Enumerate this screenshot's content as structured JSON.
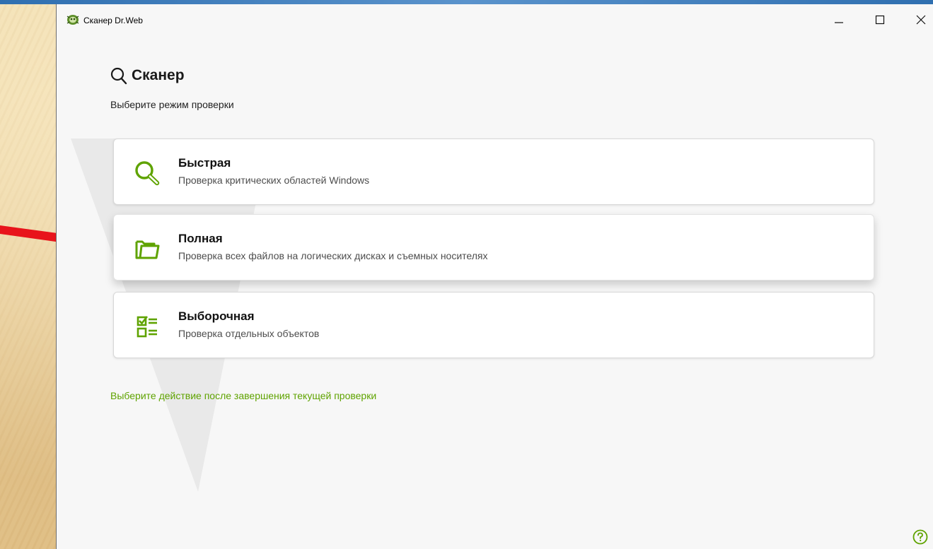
{
  "window": {
    "title": "Сканер Dr.Web"
  },
  "header": {
    "title": "Сканер",
    "subtitle": "Выберите режим проверки"
  },
  "scan_modes": [
    {
      "title": "Быстрая",
      "description": "Проверка критических областей Windows",
      "icon": "magnifier-icon"
    },
    {
      "title": "Полная",
      "description": "Проверка всех файлов на логических дисках и съемных носителях",
      "icon": "folder-icon"
    },
    {
      "title": "Выборочная",
      "description": "Проверка отдельных объектов",
      "icon": "checklist-icon"
    }
  ],
  "after_scan_link": "Выберите действие после завершения текущей проверки",
  "colors": {
    "accent_green": "#5fa300",
    "annotation_arrow": "#e8141b"
  }
}
